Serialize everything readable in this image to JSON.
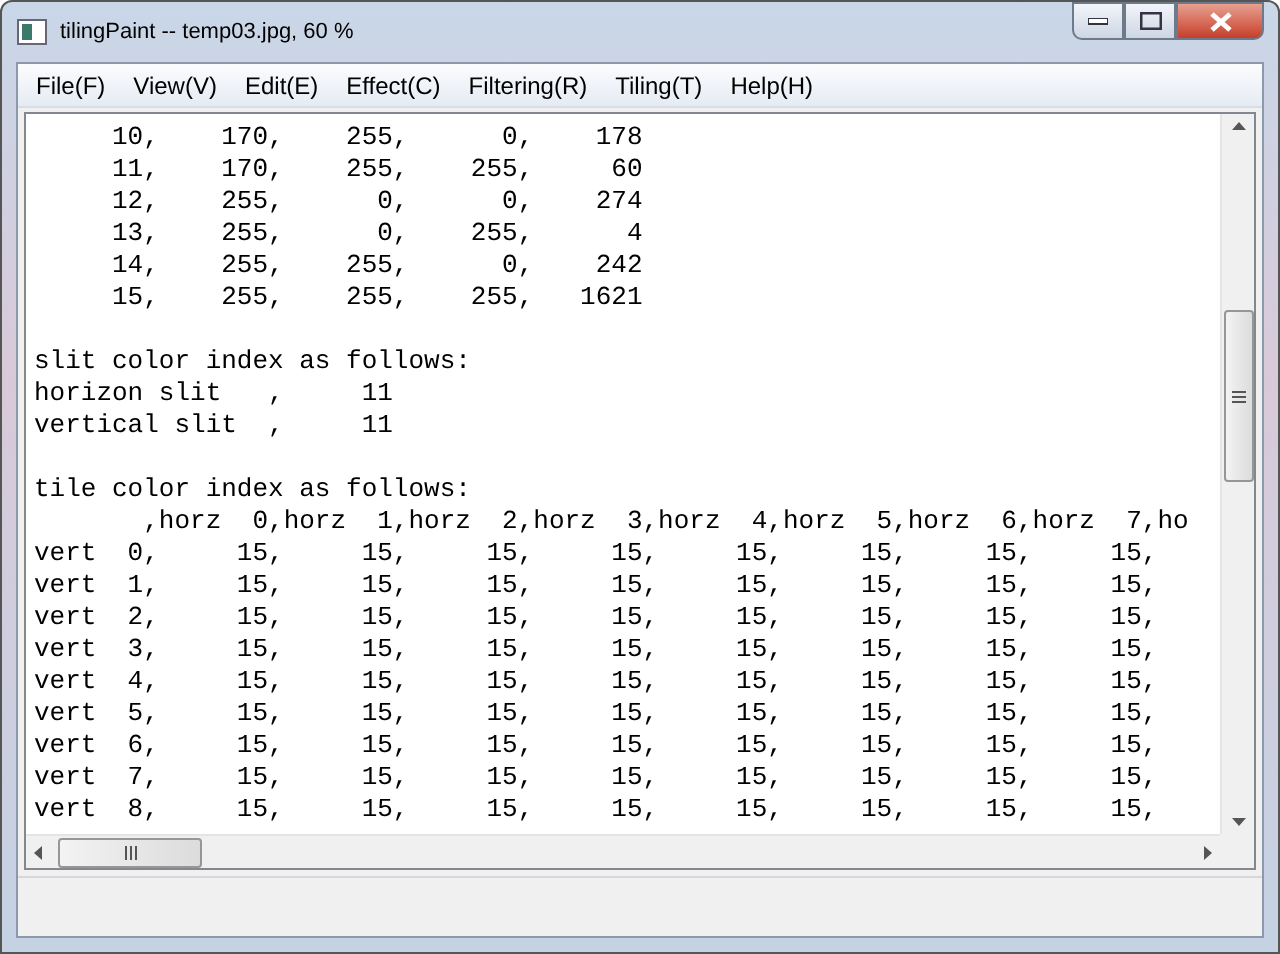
{
  "window": {
    "title": "tilingPaint -- temp03.jpg, 60 %"
  },
  "menu": [
    "File(F)",
    "View(V)",
    "Edit(E)",
    "Effect(C)",
    "Filtering(R)",
    "Tiling(T)",
    "Help(H)"
  ],
  "text_blocks": [
    [
      "     10,    170,    255,      0,    178",
      "     11,    170,    255,    255,     60",
      "     12,    255,      0,      0,    274",
      "     13,    255,      0,    255,      4",
      "     14,    255,    255,      0,    242",
      "     15,    255,    255,    255,   1621"
    ],
    [
      "slit color index as follows:",
      "horizon slit   ,     11",
      "vertical slit  ,     11"
    ],
    [
      "tile color index as follows:",
      "       ,horz  0,horz  1,horz  2,horz  3,horz  4,horz  5,horz  6,horz  7,ho",
      "vert  0,     15,     15,     15,     15,     15,     15,     15,     15,",
      "vert  1,     15,     15,     15,     15,     15,     15,     15,     15,",
      "vert  2,     15,     15,     15,     15,     15,     15,     15,     15,",
      "vert  3,     15,     15,     15,     15,     15,     15,     15,     15,",
      "vert  4,     15,     15,     15,     15,     15,     15,     15,     15,",
      "vert  5,     15,     15,     15,     15,     15,     15,     15,     15,",
      "vert  6,     15,     15,     15,     15,     15,     15,     15,     15,",
      "vert  7,     15,     15,     15,     15,     15,     15,     15,     15,",
      "vert  8,     15,     15,     15,     15,     15,     15,     15,     15,"
    ]
  ]
}
